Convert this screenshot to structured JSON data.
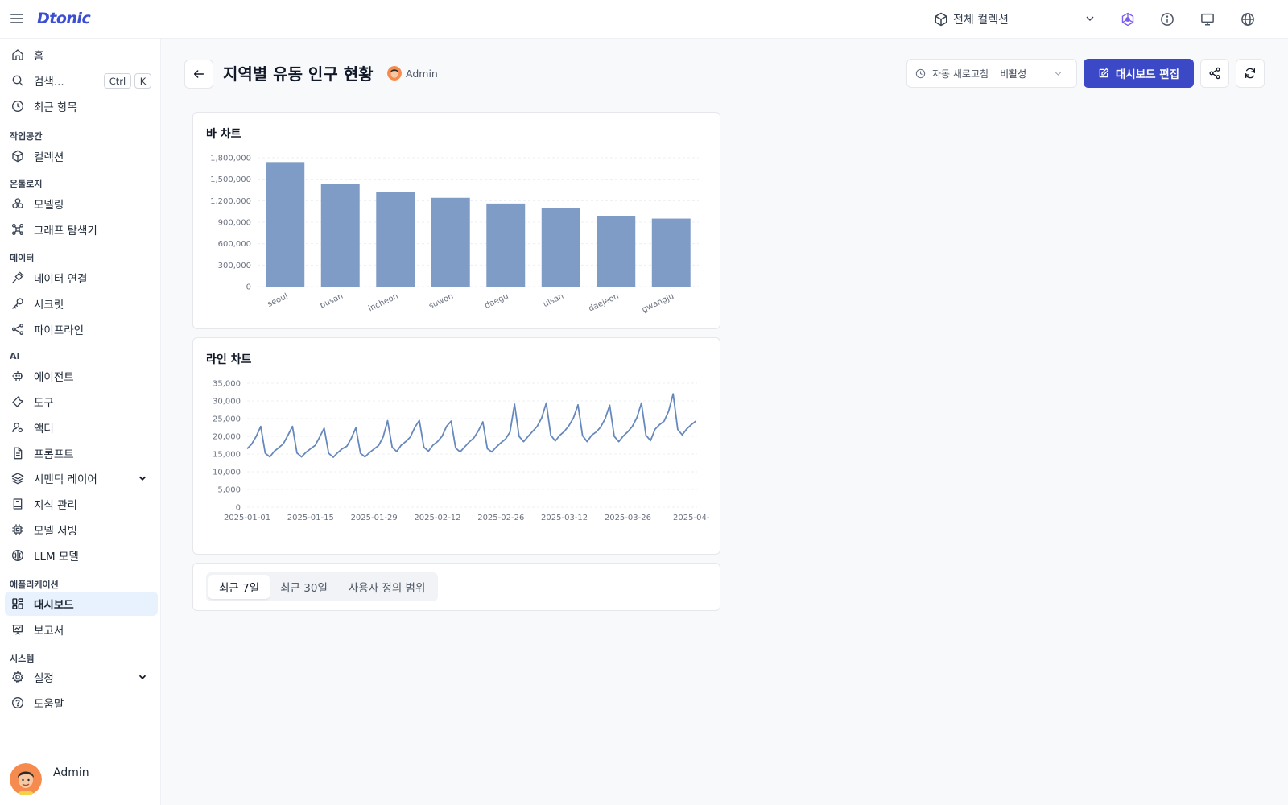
{
  "brand": {
    "logo": "Dtonic"
  },
  "topbar": {
    "collection_select": {
      "label": "전체 컬렉션",
      "icon": "cube-icon"
    },
    "icons": [
      "graph-logo-icon",
      "info-icon",
      "monitor-icon",
      "globe-icon"
    ]
  },
  "sidebar": {
    "search": {
      "label": "검색...",
      "shortcut_ctrl": "Ctrl",
      "shortcut_key": "K"
    },
    "items": {
      "home": "홈",
      "recent": "최근 항목",
      "collections": "컬렉션",
      "modeling": "모델링",
      "graph_explorer": "그래프 탐색기",
      "data_connections": "데이터 연결",
      "secrets": "시크릿",
      "pipelines": "파이프라인",
      "agents": "에이전트",
      "tools": "도구",
      "actors": "액터",
      "prompts": "프롬프트",
      "semantic_layer": "시맨틱 레이어",
      "knowledge": "지식 관리",
      "model_serving": "모델 서빙",
      "llm_models": "LLM 모델",
      "dashboards": "대시보드",
      "reports": "보고서",
      "settings": "설정",
      "help": "도움말"
    },
    "sections": {
      "workspace": "작업공간",
      "ontology": "온톨로지",
      "data": "데이터",
      "ai": "AI",
      "applications": "애플리케이션",
      "system": "시스템"
    },
    "user": {
      "name": "Admin"
    }
  },
  "header": {
    "title": "지역별 유동 인구 현황",
    "owner": "Admin",
    "refresh": {
      "label": "자동 새로고침",
      "value": "비활성"
    },
    "edit_label": "대시보드 편집"
  },
  "filter_tabs": {
    "tabs": [
      "최근 7일",
      "최근 30일",
      "사용자 정의 범위"
    ],
    "active": 0
  },
  "colors": {
    "accent": "#3b49c6",
    "bar": "#7f9cc6",
    "line": "#6688bd",
    "active_nav": "#e8f1fe"
  },
  "chart_data": [
    {
      "type": "bar",
      "title": "바 차트",
      "categories": [
        "seoul",
        "busan",
        "incheon",
        "suwon",
        "daegu",
        "ulsan",
        "daejeon",
        "gwangju"
      ],
      "values": [
        1740000,
        1440000,
        1320000,
        1240000,
        1160000,
        1100000,
        990000,
        950000
      ],
      "ylim": [
        0,
        1800000
      ],
      "yticks": [
        "0",
        "300,000",
        "600,000",
        "900,000",
        "1,200,000",
        "1,500,000",
        "1,800,000"
      ],
      "xlabel": "",
      "ylabel": "",
      "grid": true
    },
    {
      "type": "line",
      "title": "라인 차트",
      "x_start": "2025-01-01",
      "x_ticks": [
        "2025-01-01",
        "2025-01-15",
        "2025-01-29",
        "2025-02-12",
        "2025-02-26",
        "2025-03-12",
        "2025-03-26",
        "2025-04-"
      ],
      "values": [
        16500,
        17800,
        20000,
        22800,
        15200,
        14200,
        15800,
        16800,
        17900,
        20300,
        22800,
        15300,
        14200,
        15500,
        16500,
        17400,
        19800,
        22300,
        15200,
        14100,
        15400,
        16500,
        17200,
        19500,
        22400,
        15200,
        14200,
        15400,
        16400,
        17400,
        19800,
        24400,
        16900,
        15700,
        17500,
        18500,
        19800,
        22500,
        24500,
        16900,
        15800,
        17500,
        18500,
        20000,
        22800,
        24300,
        16700,
        15600,
        17000,
        18400,
        19500,
        21500,
        24100,
        16500,
        15600,
        17000,
        18200,
        19200,
        21200,
        29100,
        20000,
        18500,
        20000,
        21400,
        22800,
        25200,
        29400,
        20300,
        18700,
        20300,
        21400,
        23000,
        25200,
        28900,
        20200,
        18500,
        20300,
        21200,
        22600,
        25000,
        28800,
        20000,
        18500,
        20100,
        21300,
        22800,
        25300,
        29400,
        20300,
        18800,
        22000,
        23300,
        24300,
        27100,
        32000,
        21900,
        20400,
        22100,
        23300,
        24300
      ],
      "ylim": [
        0,
        35000
      ],
      "yticks": [
        "0",
        "5,000",
        "10,000",
        "15,000",
        "20,000",
        "25,000",
        "30,000",
        "35,000"
      ],
      "xlabel": "",
      "ylabel": "",
      "grid": true
    }
  ]
}
